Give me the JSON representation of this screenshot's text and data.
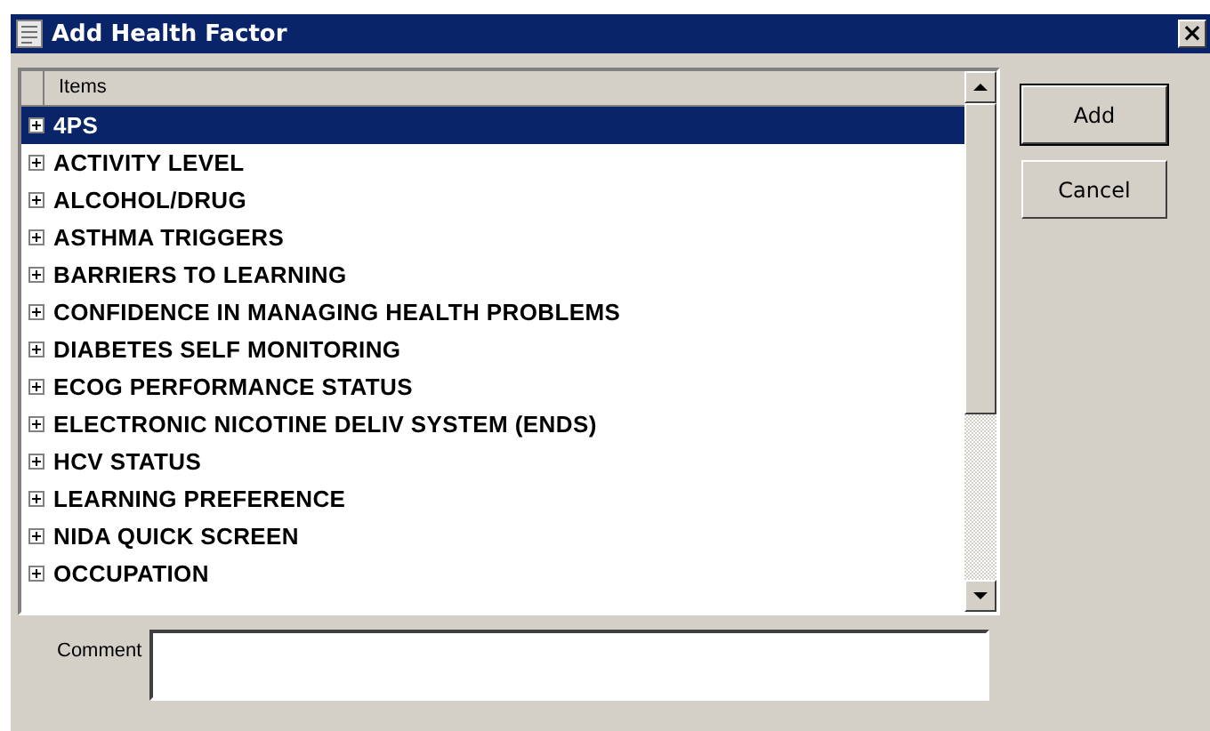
{
  "window": {
    "title": "Add Health Factor",
    "close": "×"
  },
  "list": {
    "column": "Items",
    "items": [
      {
        "label": "4PS",
        "selected": true,
        "expanded": false
      },
      {
        "label": "ACTIVITY LEVEL",
        "selected": false,
        "expanded": false
      },
      {
        "label": "ALCOHOL/DRUG",
        "selected": false,
        "expanded": false
      },
      {
        "label": "ASTHMA TRIGGERS",
        "selected": false,
        "expanded": false
      },
      {
        "label": "BARRIERS TO LEARNING",
        "selected": false,
        "expanded": false
      },
      {
        "label": "CONFIDENCE IN MANAGING HEALTH PROBLEMS",
        "selected": false,
        "expanded": false
      },
      {
        "label": "DIABETES SELF MONITORING",
        "selected": false,
        "expanded": false
      },
      {
        "label": "ECOG PERFORMANCE STATUS",
        "selected": false,
        "expanded": false
      },
      {
        "label": "ELECTRONIC NICOTINE DELIV SYSTEM (ENDS)",
        "selected": false,
        "expanded": false
      },
      {
        "label": "HCV STATUS",
        "selected": false,
        "expanded": false
      },
      {
        "label": "LEARNING PREFERENCE",
        "selected": false,
        "expanded": false
      },
      {
        "label": "NIDA QUICK SCREEN",
        "selected": false,
        "expanded": false
      },
      {
        "label": "OCCUPATION",
        "selected": false,
        "expanded": false
      }
    ]
  },
  "buttons": [
    {
      "label": "Add",
      "default": true
    },
    {
      "label": "Cancel",
      "default": false
    }
  ],
  "comment": {
    "label": "Comment"
  }
}
